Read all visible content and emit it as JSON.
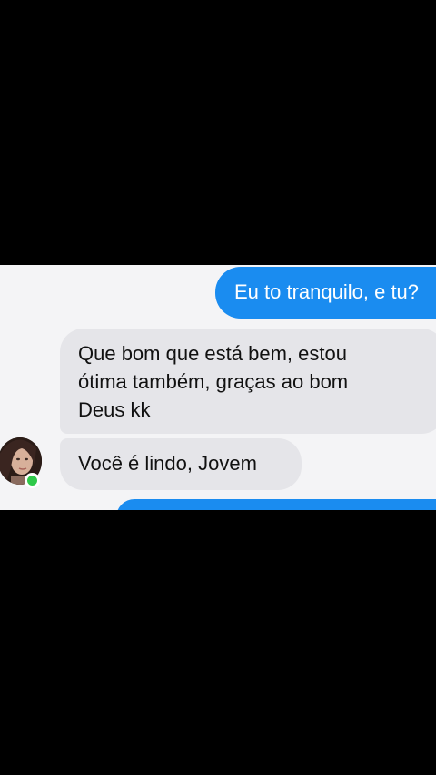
{
  "conversation": {
    "messages": [
      {
        "sender": "self",
        "text": "Eu to tranquilo, e tu?"
      },
      {
        "sender": "contact",
        "lines": [
          "Que bom que está bem, estou",
          "ótima também, graças ao bom",
          "Deus kk"
        ]
      },
      {
        "sender": "contact",
        "text": "Você é lindo, Jovem"
      },
      {
        "sender": "self",
        "text": ""
      }
    ]
  },
  "contact": {
    "avatar_icon": "profile-photo",
    "status": "online"
  },
  "colors": {
    "outgoing_bubble": "#1a8cf0",
    "incoming_bubble": "#e5e5e9",
    "online": "#2fc94a",
    "letterbox": "#000000"
  }
}
